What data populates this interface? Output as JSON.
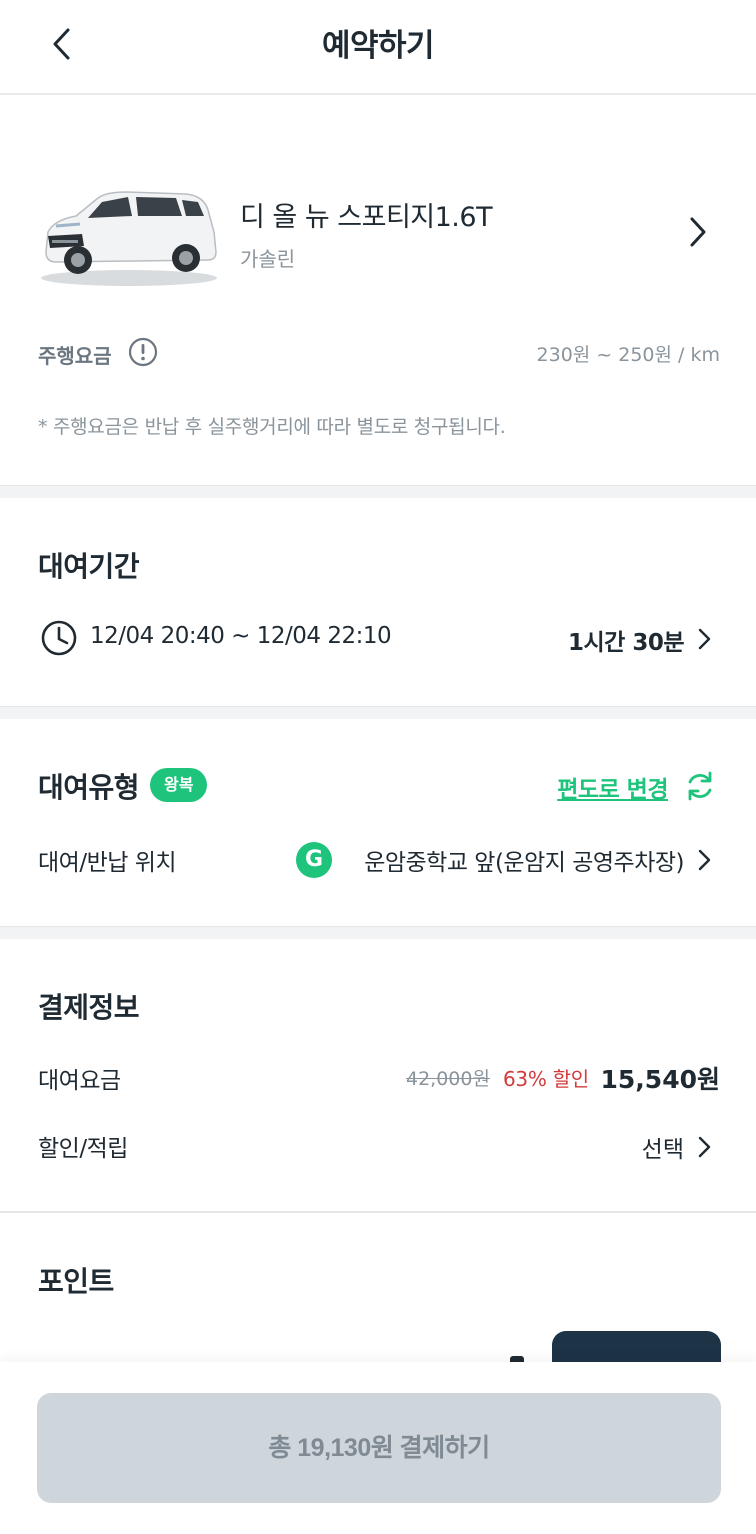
{
  "header": {
    "title": "예약하기",
    "back_icon": "chevron-left-icon"
  },
  "car": {
    "name": "디 올 뉴 스포티지1.6T",
    "fuel": "가솔린",
    "image_icon": "white-suv-image",
    "chevron_icon": "chevron-right-icon"
  },
  "driving_fee": {
    "label": "주행요금",
    "info_icon": "exclamation-info-icon",
    "value": "230원 ~ 250원 / km",
    "note": "* 주행요금은 반납 후 실주행거리에 따라 별도로 청구됩니다."
  },
  "rental_period": {
    "title": "대여기간",
    "icon": "clock-icon",
    "range": "12/04 20:40 ~ 12/04 22:10",
    "duration": "1시간 30분"
  },
  "rental_type": {
    "title": "대여유형",
    "badge": "왕복",
    "change_label": "편도로 변경",
    "change_icon": "refresh-icon",
    "location_label": "대여/반납 위치",
    "location_badge": "G",
    "location_name": "운암중학교 앞(운암지 공영주차장)"
  },
  "payment": {
    "title": "결제정보",
    "rental_fee_label": "대여요금",
    "original_price": "42,000원",
    "discount": "63% 할인",
    "final_price": "15,540원",
    "discount_label": "할인/적립",
    "select_label": "선택"
  },
  "points": {
    "title": "포인트"
  },
  "footer": {
    "pay_button_label": "총 19,130원 결제하기"
  },
  "colors": {
    "accent": "#1fc47c",
    "discount_red": "#d23b3b",
    "text_dark": "#1f2a33",
    "text_gray": "#8a949c",
    "button_disabled": "#cfd6db",
    "point_button": "#1d3346"
  }
}
